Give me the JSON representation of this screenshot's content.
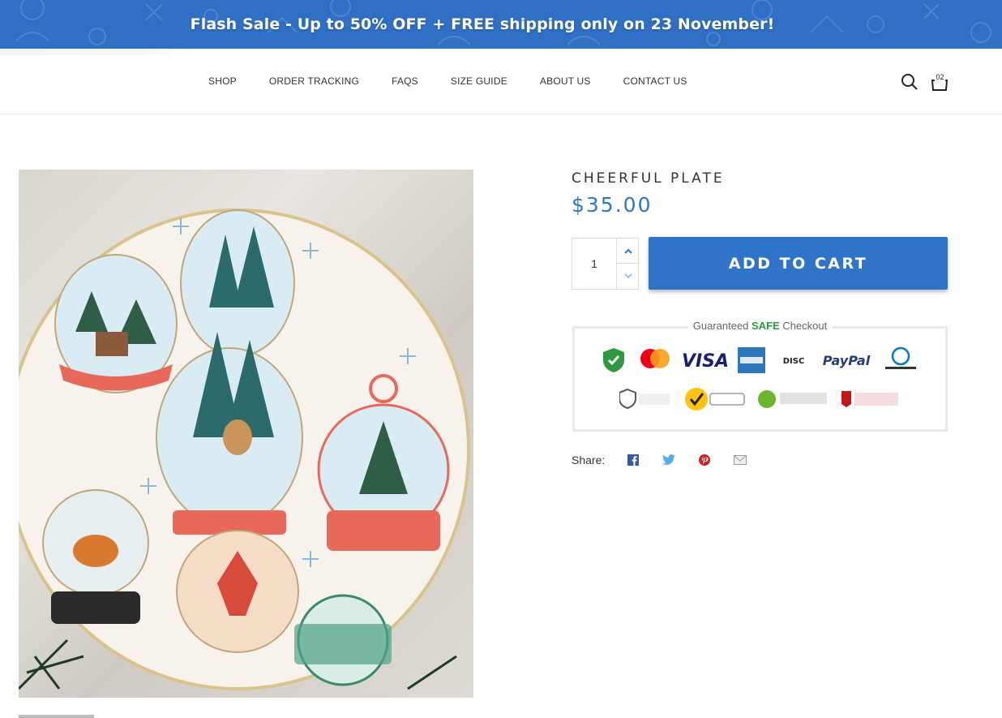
{
  "banner": {
    "text": "Flash Sale - Up to 50% OFF + FREE shipping only on 23 November!",
    "background": "#2f6fc4"
  },
  "nav": {
    "items": [
      {
        "label": "SHOP"
      },
      {
        "label": "ORDER TRACKING"
      },
      {
        "label": "FAQS"
      },
      {
        "label": "SIZE GUIDE"
      },
      {
        "label": "ABOUT US"
      },
      {
        "label": "CONTACT US"
      }
    ]
  },
  "header": {
    "search_icon": "search-icon",
    "cart_icon": "shopping-bag-icon",
    "cart_count": "02"
  },
  "product": {
    "title": "CHEERFUL PLATE",
    "price": "$35.00",
    "quantity": "1",
    "add_to_cart_label": "ADD TO CART",
    "accent_color": "#2f74c8"
  },
  "trust_badge": {
    "title_prefix": "Guaranteed ",
    "title_highlight": "SAFE",
    "title_suffix": " Checkout",
    "row1": [
      "AES-256 bit",
      "mastercard",
      "VISA",
      "AMERICAN EXPRESS",
      "DISCOVER",
      "PayPal",
      "Diners Club INTERNATIONAL"
    ],
    "row2": [
      "Powered by stripe",
      "Norton SECURED",
      "TRUSTe CERTIFIED PRIVACY",
      "McAfee SECURE"
    ]
  },
  "share": {
    "label": "Share:",
    "icons": [
      "facebook-icon",
      "twitter-icon",
      "pinterest-icon",
      "email-icon"
    ]
  }
}
